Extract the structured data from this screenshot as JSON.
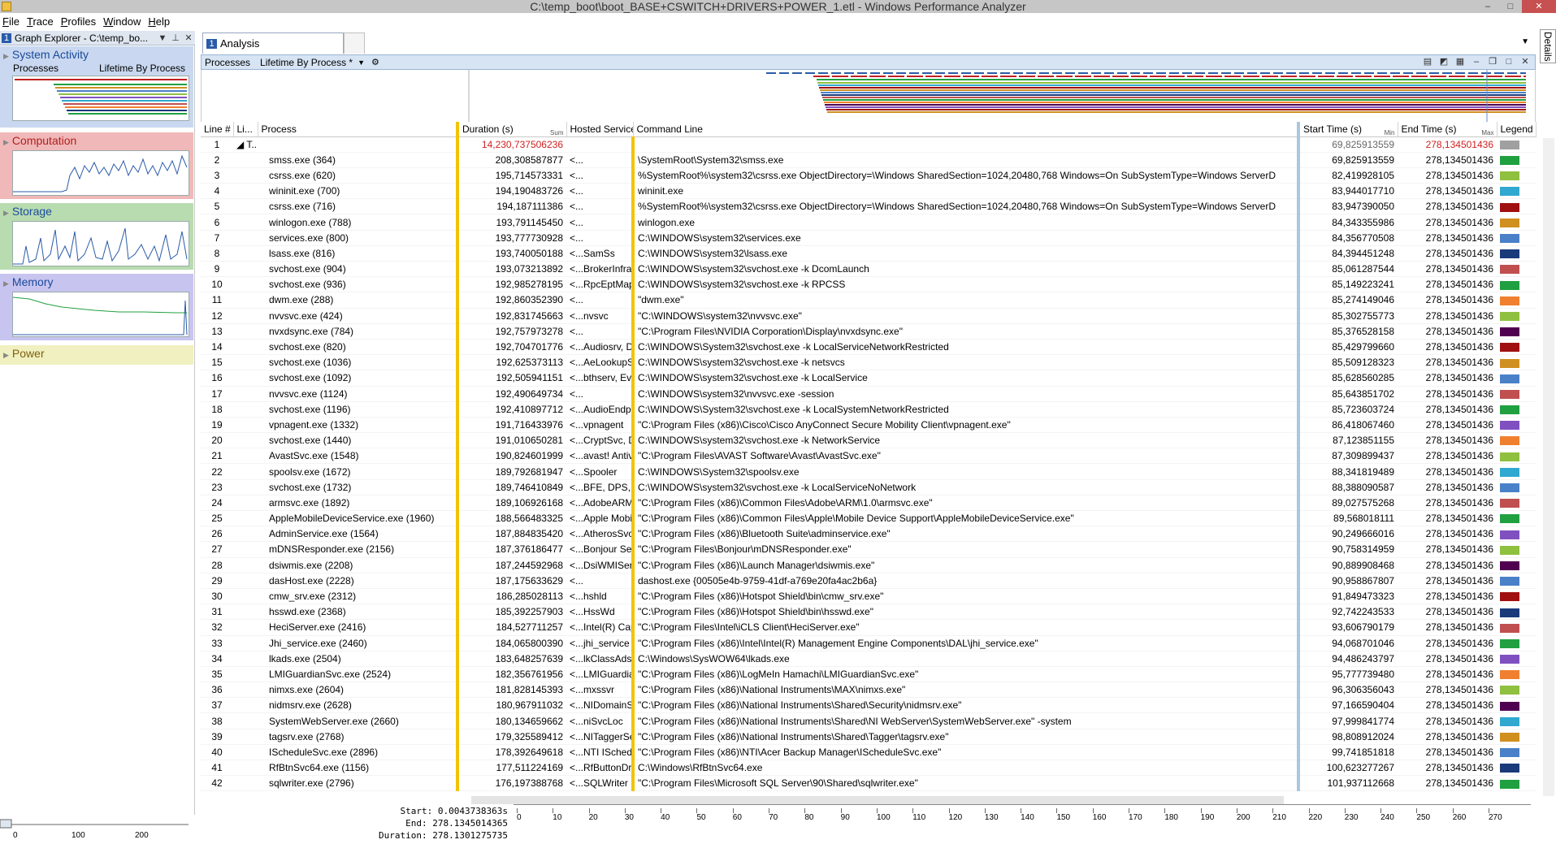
{
  "window": {
    "title": "C:\\temp_boot\\boot_BASE+CSWITCH+DRIVERS+POWER_1.etl - Windows Performance Analyzer",
    "min": "–",
    "max": "□",
    "close": "✕"
  },
  "menu": [
    "File",
    "Trace",
    "Profiles",
    "Window",
    "Help"
  ],
  "graph_explorer": {
    "num": "1",
    "title": "Graph Explorer - C:\\temp_bo...",
    "categories": [
      {
        "name": "System Activity",
        "sub_left": "Processes",
        "sub_right": "Lifetime By Process",
        "color": "#c9d8f0"
      },
      {
        "name": "Computation",
        "color": "#f0b8b8"
      },
      {
        "name": "Storage",
        "color": "#b8dcb0"
      },
      {
        "name": "Memory",
        "color": "#c8c4f0"
      },
      {
        "name": "Power",
        "color": "#f0f0c0"
      }
    ],
    "axis_ticks": [
      "0",
      "100",
      "200"
    ]
  },
  "tabs": {
    "analysis": {
      "num": "1",
      "label": "Analysis"
    }
  },
  "details_label": "Details",
  "view": {
    "title": "Processes",
    "preset": "Lifetime By Process *"
  },
  "columns": {
    "line": "Line #",
    "li": "Li...",
    "process": "Process",
    "duration": "Duration (s)",
    "duration_agg": "Sum",
    "sort_dot": "·",
    "hosted": "Hosted Services",
    "cmd": "Command Line",
    "start": "Start Time (s)",
    "start_agg": "Min",
    "end": "End Time (s)",
    "end_agg": "Max",
    "legend": "Legend"
  },
  "total_row": {
    "line": "1",
    "li": "◢ T...",
    "duration": "14,230,737506236",
    "start": "69,825913559",
    "end": "278,134501436",
    "color": "#a0a0a0"
  },
  "rows": [
    {
      "line": "2",
      "process": "smss.exe (364)",
      "duration": "208,308587877",
      "hosted": "<...",
      "cmd": "\\SystemRoot\\System32\\smss.exe",
      "start": "69,825913559",
      "end": "278,134501436",
      "color": "#20a040"
    },
    {
      "line": "3",
      "process": "csrss.exe (620)",
      "duration": "195,714573331",
      "hosted": "<...",
      "cmd": "%SystemRoot%\\system32\\csrss.exe ObjectDirectory=\\Windows SharedSection=1024,20480,768 Windows=On SubSystemType=Windows ServerD",
      "start": "82,419928105",
      "end": "278,134501436",
      "color": "#90c040"
    },
    {
      "line": "4",
      "process": "wininit.exe (700)",
      "duration": "194,190483726",
      "hosted": "<...",
      "cmd": "wininit.exe",
      "start": "83,944017710",
      "end": "278,134501436",
      "color": "#30a8d0"
    },
    {
      "line": "5",
      "process": "csrss.exe (716)",
      "duration": "194,187111386",
      "hosted": "<...",
      "cmd": "%SystemRoot%\\system32\\csrss.exe ObjectDirectory=\\Windows SharedSection=1024,20480,768 Windows=On SubSystemType=Windows ServerD",
      "start": "83,947390050",
      "end": "278,134501436",
      "color": "#a01010"
    },
    {
      "line": "6",
      "process": "winlogon.exe (788)",
      "duration": "193,791145450",
      "hosted": "<...",
      "cmd": "winlogon.exe",
      "start": "84,343355986",
      "end": "278,134501436",
      "color": "#d09020"
    },
    {
      "line": "7",
      "process": "services.exe (800)",
      "duration": "193,777730928",
      "hosted": "<...",
      "cmd": "C:\\WINDOWS\\system32\\services.exe",
      "start": "84,356770508",
      "end": "278,134501436",
      "color": "#4a80c8"
    },
    {
      "line": "8",
      "process": "lsass.exe (816)",
      "duration": "193,740050188",
      "hosted": "<...SamSs",
      "cmd": "C:\\WINDOWS\\system32\\lsass.exe",
      "start": "84,394451248",
      "end": "278,134501436",
      "color": "#1a3a7a"
    },
    {
      "line": "9",
      "process": "svchost.exe (904)",
      "duration": "193,073213892",
      "hosted": "<...BrokerInfrastruct...",
      "cmd": "C:\\WINDOWS\\system32\\svchost.exe -k DcomLaunch",
      "start": "85,061287544",
      "end": "278,134501436",
      "color": "#c05050"
    },
    {
      "line": "10",
      "process": "svchost.exe (936)",
      "duration": "192,985278195",
      "hosted": "<...RpcEptMapper,...",
      "cmd": "C:\\WINDOWS\\system32\\svchost.exe -k RPCSS",
      "start": "85,149223241",
      "end": "278,134501436",
      "color": "#20a040"
    },
    {
      "line": "11",
      "process": "dwm.exe (288)",
      "duration": "192,860352390",
      "hosted": "<...",
      "cmd": "\"dwm.exe\"",
      "start": "85,274149046",
      "end": "278,134501436",
      "color": "#f08030"
    },
    {
      "line": "12",
      "process": "nvvsvc.exe (424)",
      "duration": "192,831745663",
      "hosted": "<...nvsvc",
      "cmd": "\"C:\\WINDOWS\\system32\\nvvsvc.exe\"",
      "start": "85,302755773",
      "end": "278,134501436",
      "color": "#90c040"
    },
    {
      "line": "13",
      "process": "nvxdsync.exe (784)",
      "duration": "192,757973278",
      "hosted": "<...",
      "cmd": "\"C:\\Program Files\\NVIDIA Corporation\\Display\\nvxdsync.exe\"",
      "start": "85,376528158",
      "end": "278,134501436",
      "color": "#500050"
    },
    {
      "line": "14",
      "process": "svchost.exe (820)",
      "duration": "192,704701776",
      "hosted": "<...Audiosrv, Dhcp,...",
      "cmd": "C:\\WINDOWS\\System32\\svchost.exe -k LocalServiceNetworkRestricted",
      "start": "85,429799660",
      "end": "278,134501436",
      "color": "#a01010"
    },
    {
      "line": "15",
      "process": "svchost.exe (1036)",
      "duration": "192,625373113",
      "hosted": "<...AeLookupSvc, A...",
      "cmd": "C:\\WINDOWS\\system32\\svchost.exe -k netsvcs",
      "start": "85,509128323",
      "end": "278,134501436",
      "color": "#d09020"
    },
    {
      "line": "16",
      "process": "svchost.exe (1092)",
      "duration": "192,505941151",
      "hosted": "<...bthserv, EventSy...",
      "cmd": "C:\\WINDOWS\\system32\\svchost.exe -k LocalService",
      "start": "85,628560285",
      "end": "278,134501436",
      "color": "#4a80c8"
    },
    {
      "line": "17",
      "process": "nvvsvc.exe (1124)",
      "duration": "192,490649734",
      "hosted": "<...",
      "cmd": "C:\\WINDOWS\\system32\\nvvsvc.exe -session",
      "start": "85,643851702",
      "end": "278,134501436",
      "color": "#c05050"
    },
    {
      "line": "18",
      "process": "svchost.exe (1196)",
      "duration": "192,410897712",
      "hosted": "<...AudioEndpointB...",
      "cmd": "C:\\WINDOWS\\System32\\svchost.exe -k LocalSystemNetworkRestricted",
      "start": "85,723603724",
      "end": "278,134501436",
      "color": "#20a040"
    },
    {
      "line": "19",
      "process": "vpnagent.exe (1332)",
      "duration": "191,716433976",
      "hosted": "<...vpnagent",
      "cmd": "\"C:\\Program Files (x86)\\Cisco\\Cisco AnyConnect Secure Mobility Client\\vpnagent.exe\"",
      "start": "86,418067460",
      "end": "278,134501436",
      "color": "#8050c0"
    },
    {
      "line": "20",
      "process": "svchost.exe (1440)",
      "duration": "191,010650281",
      "hosted": "<...CryptSvc, Dnsca...",
      "cmd": "C:\\WINDOWS\\system32\\svchost.exe -k NetworkService",
      "start": "87,123851155",
      "end": "278,134501436",
      "color": "#f08030"
    },
    {
      "line": "21",
      "process": "AvastSvc.exe (1548)",
      "duration": "190,824601999",
      "hosted": "<...avast! Antivirus",
      "cmd": "\"C:\\Program Files\\AVAST Software\\Avast\\AvastSvc.exe\"",
      "start": "87,309899437",
      "end": "278,134501436",
      "color": "#90c040"
    },
    {
      "line": "22",
      "process": "spoolsv.exe (1672)",
      "duration": "189,792681947",
      "hosted": "<...Spooler",
      "cmd": "C:\\WINDOWS\\System32\\spoolsv.exe",
      "start": "88,341819489",
      "end": "278,134501436",
      "color": "#30a8d0"
    },
    {
      "line": "23",
      "process": "svchost.exe (1732)",
      "duration": "189,746410849",
      "hosted": "<...BFE, DPS, MpsSvc",
      "cmd": "C:\\WINDOWS\\system32\\svchost.exe -k LocalServiceNoNetwork",
      "start": "88,388090587",
      "end": "278,134501436",
      "color": "#4a80c8"
    },
    {
      "line": "24",
      "process": "armsvc.exe (1892)",
      "duration": "189,106926168",
      "hosted": "<...AdobeARMservice",
      "cmd": "\"C:\\Program Files (x86)\\Common Files\\Adobe\\ARM\\1.0\\armsvc.exe\"",
      "start": "89,027575268",
      "end": "278,134501436",
      "color": "#c05050"
    },
    {
      "line": "25",
      "process": "AppleMobileDeviceService.exe (1960)",
      "duration": "188,566483325",
      "hosted": "<...Apple Mobile De...",
      "cmd": "\"C:\\Program Files (x86)\\Common Files\\Apple\\Mobile Device Support\\AppleMobileDeviceService.exe\"",
      "start": "89,568018111",
      "end": "278,134501436",
      "color": "#20a040"
    },
    {
      "line": "26",
      "process": "AdminService.exe (1564)",
      "duration": "187,884835420",
      "hosted": "<...AtherosSvc",
      "cmd": "\"C:\\Program Files (x86)\\Bluetooth Suite\\adminservice.exe\"",
      "start": "90,249666016",
      "end": "278,134501436",
      "color": "#8050c0"
    },
    {
      "line": "27",
      "process": "mDNSResponder.exe (2156)",
      "duration": "187,376186477",
      "hosted": "<...Bonjour Service",
      "cmd": "\"C:\\Program Files\\Bonjour\\mDNSResponder.exe\"",
      "start": "90,758314959",
      "end": "278,134501436",
      "color": "#90c040"
    },
    {
      "line": "28",
      "process": "dsiwmis.exe (2208)",
      "duration": "187,244592968",
      "hosted": "<...DsiWMIService",
      "cmd": "\"C:\\Program Files (x86)\\Launch Manager\\dsiwmis.exe\"",
      "start": "90,889908468",
      "end": "278,134501436",
      "color": "#500050"
    },
    {
      "line": "29",
      "process": "dasHost.exe (2228)",
      "duration": "187,175633629",
      "hosted": "<...",
      "cmd": "dashost.exe {00505e4b-9759-41df-a769e20fa4ac2b6a}",
      "start": "90,958867807",
      "end": "278,134501436",
      "color": "#4a80c8"
    },
    {
      "line": "30",
      "process": "cmw_srv.exe (2312)",
      "duration": "186,285028113",
      "hosted": "<...hshld",
      "cmd": "\"C:\\Program Files (x86)\\Hotspot Shield\\bin\\cmw_srv.exe\"",
      "start": "91,849473323",
      "end": "278,134501436",
      "color": "#a01010"
    },
    {
      "line": "31",
      "process": "hsswd.exe (2368)",
      "duration": "185,392257903",
      "hosted": "<...HssWd",
      "cmd": "\"C:\\Program Files (x86)\\Hotspot Shield\\bin\\hsswd.exe\"",
      "start": "92,742243533",
      "end": "278,134501436",
      "color": "#1a3a7a"
    },
    {
      "line": "32",
      "process": "HeciServer.exe (2416)",
      "duration": "184,527711257",
      "hosted": "<...Intel(R) Capabilit...",
      "cmd": "\"C:\\Program Files\\Intel\\iCLS Client\\HeciServer.exe\"",
      "start": "93,606790179",
      "end": "278,134501436",
      "color": "#c05050"
    },
    {
      "line": "33",
      "process": "Jhi_service.exe (2460)",
      "duration": "184,065800390",
      "hosted": "<...jhi_service",
      "cmd": "\"C:\\Program Files (x86)\\Intel\\Intel(R) Management Engine Components\\DAL\\jhi_service.exe\"",
      "start": "94,068701046",
      "end": "278,134501436",
      "color": "#20a040"
    },
    {
      "line": "34",
      "process": "lkads.exe (2504)",
      "duration": "183,648257639",
      "hosted": "<...lkClassAds",
      "cmd": "C:\\Windows\\SysWOW64\\lkads.exe",
      "start": "94,486243797",
      "end": "278,134501436",
      "color": "#8050c0"
    },
    {
      "line": "35",
      "process": "LMIGuardianSvc.exe (2524)",
      "duration": "182,356761956",
      "hosted": "<...LMIGuardianSvc",
      "cmd": "\"C:\\Program Files (x86)\\LogMeIn Hamachi\\LMIGuardianSvc.exe\"",
      "start": "95,777739480",
      "end": "278,134501436",
      "color": "#f08030"
    },
    {
      "line": "36",
      "process": "nimxs.exe (2604)",
      "duration": "181,828145393",
      "hosted": "<...mxssvr",
      "cmd": "\"C:\\Program Files (x86)\\National Instruments\\MAX\\nimxs.exe\"",
      "start": "96,306356043",
      "end": "278,134501436",
      "color": "#90c040"
    },
    {
      "line": "37",
      "process": "nidmsrv.exe (2628)",
      "duration": "180,967911032",
      "hosted": "<...NIDomainService",
      "cmd": "\"C:\\Program Files (x86)\\National Instruments\\Shared\\Security\\nidmsrv.exe\"",
      "start": "97,166590404",
      "end": "278,134501436",
      "color": "#500050"
    },
    {
      "line": "38",
      "process": "SystemWebServer.exe (2660)",
      "duration": "180,134659662",
      "hosted": "<...niSvcLoc",
      "cmd": "\"C:\\Program Files (x86)\\National Instruments\\Shared\\NI WebServer\\SystemWebServer.exe\" -system",
      "start": "97,999841774",
      "end": "278,134501436",
      "color": "#30a8d0"
    },
    {
      "line": "39",
      "process": "tagsrv.exe (2768)",
      "duration": "179,325589412",
      "hosted": "<...NITaggerService",
      "cmd": "\"C:\\Program Files (x86)\\National Instruments\\Shared\\Tagger\\tagsrv.exe\"",
      "start": "98,808912024",
      "end": "278,134501436",
      "color": "#d09020"
    },
    {
      "line": "40",
      "process": "IScheduleSvc.exe (2896)",
      "duration": "178,392649618",
      "hosted": "<...NTI IScheduleSvc",
      "cmd": "\"C:\\Program Files (x86)\\NTI\\Acer Backup Manager\\IScheduleSvc.exe\"",
      "start": "99,741851818",
      "end": "278,134501436",
      "color": "#4a80c8"
    },
    {
      "line": "41",
      "process": "RfBtnSvc64.exe (1156)",
      "duration": "177,511224169",
      "hosted": "<...RfButtonDriverS...",
      "cmd": "C:\\Windows\\RfBtnSvc64.exe",
      "start": "100,623277267",
      "end": "278,134501436",
      "color": "#1a3a7a"
    },
    {
      "line": "42",
      "process": "sqlwriter.exe (2796)",
      "duration": "176,197388768",
      "hosted": "<...SQLWriter",
      "cmd": "\"C:\\Program Files\\Microsoft SQL Server\\90\\Shared\\sqlwriter.exe\"",
      "start": "101,937112668",
      "end": "278,134501436",
      "color": "#20a040"
    }
  ],
  "timeline": {
    "start_label": "Start:",
    "start_val": "0.0043738363s",
    "end_label": "End:",
    "end_val": "278.1345014365",
    "dur_label": "Duration:",
    "dur_val": "278.1301275735",
    "ticks": [
      "0",
      "10",
      "20",
      "30",
      "40",
      "50",
      "60",
      "70",
      "80",
      "90",
      "100",
      "110",
      "120",
      "130",
      "140",
      "150",
      "160",
      "170",
      "180",
      "190",
      "200",
      "210",
      "220",
      "230",
      "240",
      "250",
      "260",
      "270"
    ]
  }
}
